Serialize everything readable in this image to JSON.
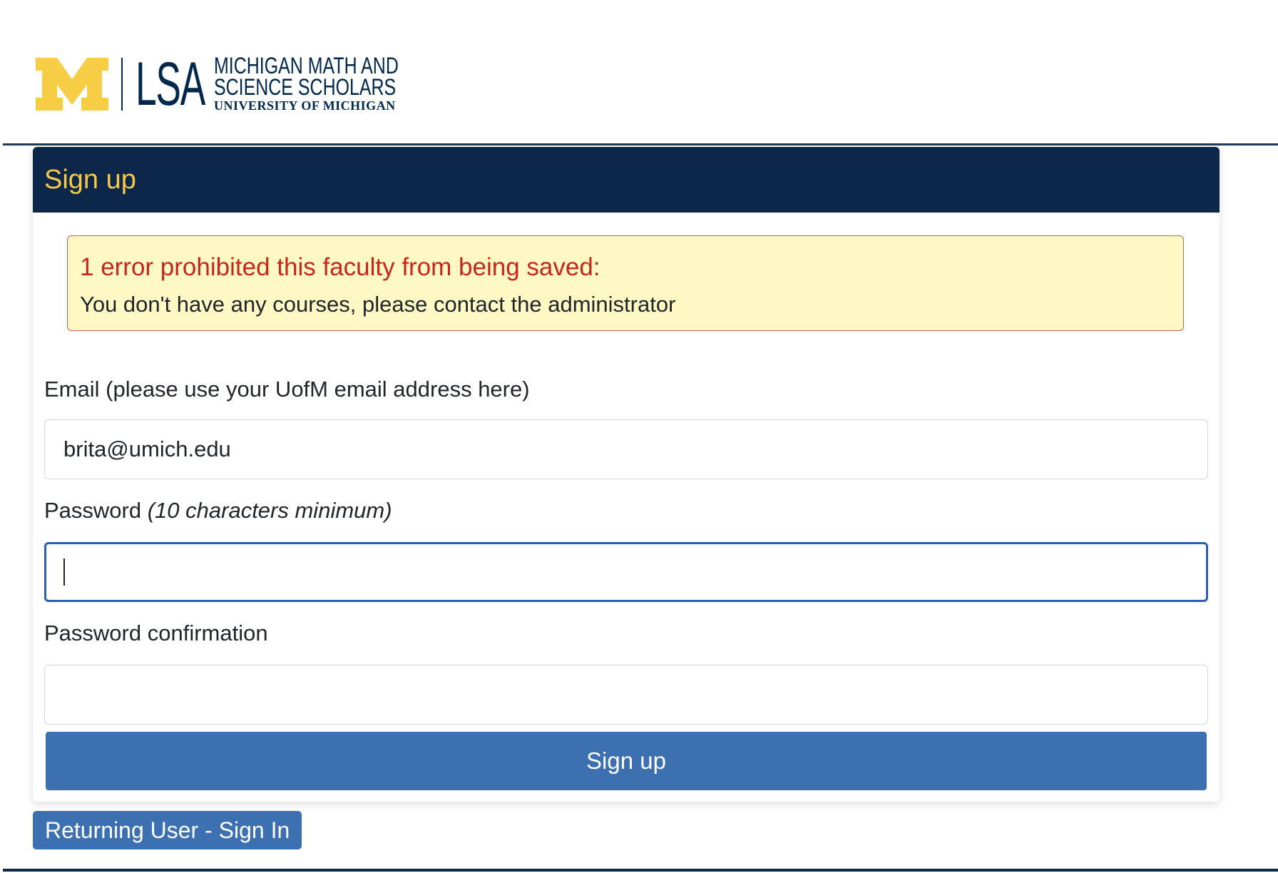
{
  "branding": {
    "lsa": "LSA",
    "line1": "MICHIGAN MATH AND",
    "line2": "SCIENCE SCHOLARS",
    "line3": "UNIVERSITY OF MICHIGAN",
    "colors": {
      "maize": "#f7cd46",
      "blue": "#00274c"
    }
  },
  "card": {
    "title": "Sign up"
  },
  "alert": {
    "heading": "1 error prohibited this faculty from being saved:",
    "message": "You don't have any courses, please contact the administrator"
  },
  "form": {
    "email_label": "Email (please use your UofM email address here)",
    "email_value": "brita@umich.edu",
    "password_label": "Password",
    "password_hint": "(10 characters minimum)",
    "password_value": "",
    "password_confirmation_label": "Password confirmation",
    "password_confirmation_value": "",
    "submit_label": "Sign up"
  },
  "links": {
    "returning_user": "Returning User - Sign In"
  }
}
